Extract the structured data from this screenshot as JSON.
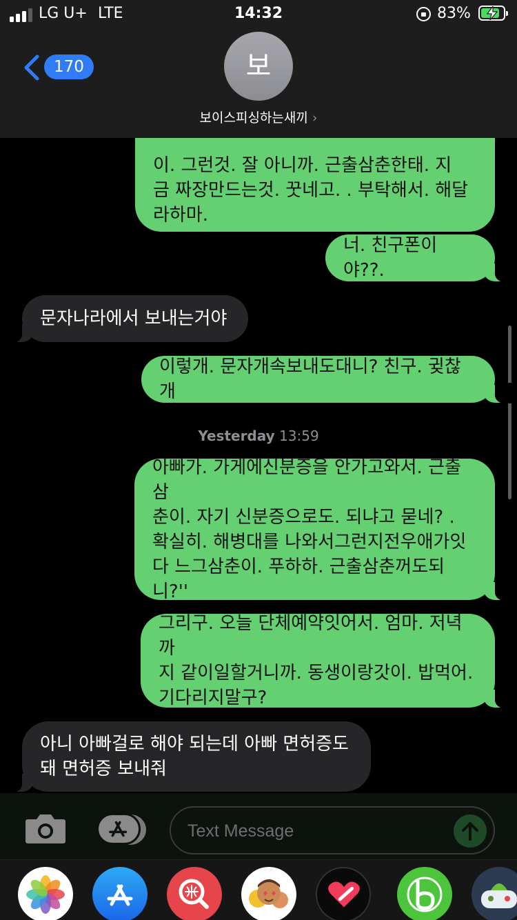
{
  "status_bar": {
    "carrier": "LG U+",
    "network": "LTE",
    "time": "14:32",
    "battery_percent": "83%",
    "battery_level": 0.83,
    "signal_bars": 3
  },
  "header": {
    "back_count": "170",
    "avatar_initial": "보",
    "contact_name": "보이스피싱하는새끼",
    "name_chevron": "›"
  },
  "messages": [
    {
      "dir": "sent",
      "text": "이. 그런것. 잘 아니까.    근출삼춘한태. 지\n금  짜장만드는것. 꿋네고. . 부탁해서.  해달\n라하마."
    },
    {
      "dir": "sent",
      "text": "너. 친구폰이야??."
    },
    {
      "dir": "recv",
      "text": "문자나라에서 보내는거야"
    },
    {
      "dir": "sent",
      "text": "이렇개. 문자개속보내도대니? 친구. 귖찮개"
    },
    {
      "dir": "sent",
      "text": "아빠가. 가게에신분증을 안가고와서. 근출삼\n춘이.  자기 신분증으로도. 되냐고 묻네?  .\n확실히. 해병대를 나와서그런지전우애가잇\n다 느그삼춘이. 푸하하.   근출삼춘꺼도되\n니?''"
    },
    {
      "dir": "sent",
      "text": "그리구. 오늘 단체예약잇어서. 엄마. 저녁까\n지 같이일할거니까. 동생이랑갓이. 밥먹어.\n기다리지말구?"
    },
    {
      "dir": "recv",
      "text": "아니 아빠걸로 해야 되는데 아빠 면허증도\n돼 면허증 보내줘"
    }
  ],
  "timestamp": {
    "day": "Yesterday",
    "time": "13:59"
  },
  "composer": {
    "placeholder": "Text Message"
  },
  "apps": [
    "photos-icon",
    "app-store-icon",
    "web-search-icon",
    "memoji-icon",
    "digital-touch-icon",
    "bing-app-icon",
    "game-app-icon"
  ],
  "colors": {
    "sent_bubble": "#65d072",
    "received_bubble": "#262628",
    "back_badge": "#2f7cf6",
    "battery_fill": "#4cd964"
  }
}
